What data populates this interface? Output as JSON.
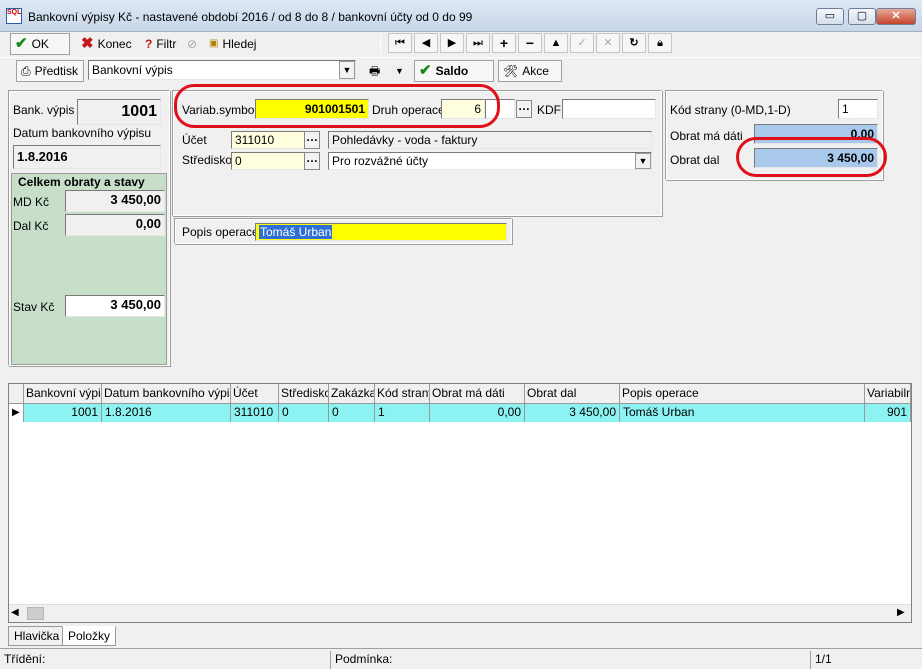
{
  "window": {
    "title": "Bankovní výpisy Kč - nastavené období 2016 / od 8 do 8 / bankovní účty od 0 do 99",
    "icon_text": "SQL",
    "minimize": "▭",
    "maximize": "▢",
    "close": "✕"
  },
  "toolbar": {
    "ok": "OK",
    "konec": "Konec",
    "filtr": "Filtr",
    "hledej": "Hledej"
  },
  "toolbar2": {
    "predtisk": "Předtisk",
    "report_value": "Bankovní výpis",
    "saldo": "Saldo",
    "akce": "Akce"
  },
  "left_panel": {
    "bank_vypis_label": "Bank. výpis",
    "bank_vypis_value": "1001",
    "datum_label": "Datum bankovního výpisu",
    "datum_value": "1.8.2016",
    "group_title": "Celkem obraty a stavy",
    "md_label": "MD Kč",
    "md_value": "3 450,00",
    "dal_label": "Dal Kč",
    "dal_value": "0,00",
    "stav_label": "Stav Kč",
    "stav_value": "3 450,00"
  },
  "center_panel": {
    "variab_label": "Variab.symbol",
    "variab_value": "901001501",
    "druh_label": "Druh operace",
    "druh_value": "6",
    "kdf_label": "KDF",
    "kdf_value": "",
    "ucet_label": "Účet",
    "ucet_value": "311010",
    "ucet_desc": "Pohledávky - voda - faktury",
    "stredisko_label": "Středisko",
    "stredisko_value": "0",
    "stredisko_desc": "Pro rozvážné účty",
    "popis_label": "Popis operace",
    "popis_value": "Tomáš Urban"
  },
  "right_panel": {
    "kod_label": "Kód strany (0-MD,1-D)",
    "kod_value": "1",
    "obrat_md_label": "Obrat má dáti",
    "obrat_md_value": "0,00",
    "obrat_dal_label": "Obrat dal",
    "obrat_dal_value": "3 450,00"
  },
  "grid": {
    "columns": [
      "Bankovní výpis",
      "Datum bankovního výpisu",
      "Účet",
      "Středisko",
      "Zakázka",
      "Kód strany",
      "Obrat má dáti",
      "Obrat dal",
      "Popis operace",
      "Variabilní"
    ],
    "rows": [
      [
        "1001",
        "1.8.2016",
        "311010",
        "0",
        "0",
        "1",
        "0,00",
        "3 450,00",
        "Tomáš Urban",
        "901"
      ]
    ]
  },
  "tabs": [
    "Hlavička",
    "Položky"
  ],
  "status": {
    "trideni": "Třídění:",
    "podminka": "Podmínka:",
    "page": "1/1"
  },
  "colors": {
    "highlight_yellow": "#ffff00",
    "obrat_blue": "#a9c9ec",
    "row_cyan": "#8df3f2",
    "group_green": "#c7dfc9",
    "annotation_red": "#e0101a"
  }
}
